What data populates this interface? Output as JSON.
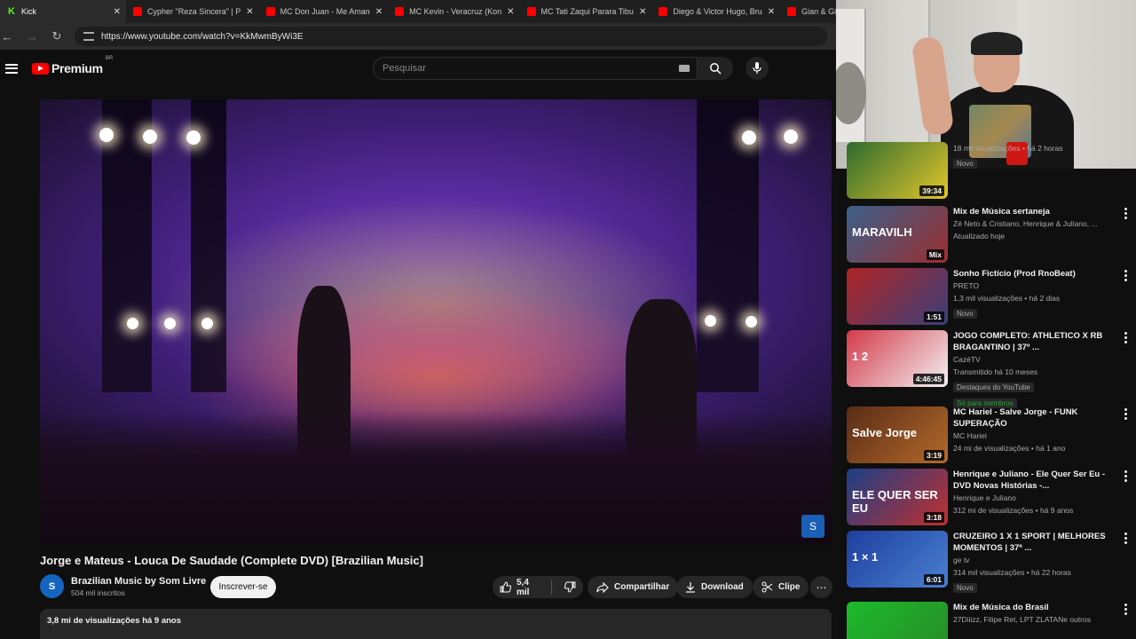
{
  "browser": {
    "tabs": [
      {
        "label": "Kick",
        "fav": "kick",
        "active": true
      },
      {
        "label": "Cypher \"Reza Sincera\" | P",
        "fav": "yt"
      },
      {
        "label": "MC Don Juan - Me Aman",
        "fav": "yt"
      },
      {
        "label": "MC Kevin - Veracruz (Kon",
        "fav": "yt"
      },
      {
        "label": "MC Tati Zaqui Parara Tibu",
        "fav": "yt"
      },
      {
        "label": "Diego & Victor Hugo, Bru",
        "fav": "yt"
      },
      {
        "label": "Gian & Giovani",
        "fav": "yt"
      }
    ],
    "close_glyph": "✕",
    "url": "https://www.youtube.com/watch?v=KkMwmByWi3E"
  },
  "youtube": {
    "logo_text": "Premium",
    "country_code": "BR",
    "search_placeholder": "Pesquisar"
  },
  "video": {
    "title": "Jorge e Mateus - Louca De Saudade (Complete DVD) [Brazilian Music]",
    "channel": "Brazilian Music by Som Livre",
    "subscribers": "504 mil inscritos",
    "subscribe_label": "Inscrever-se",
    "likes": "5,4 mil",
    "share_label": "Compartilhar",
    "download_label": "Download",
    "clip_label": "Clipe",
    "views_date": "3,8 mi de visualizações  há 9 anos"
  },
  "sidebar": {
    "items": [
      {
        "title": "",
        "lines": [
          "18 mil visualizações • há 2 horas"
        ],
        "badge": "Novo",
        "duration": "39:34",
        "colors": [
          "#2e6b2e",
          "#e2c62a"
        ]
      },
      {
        "title": "Mix de Música sertaneja",
        "lines": [
          "Zé Neto & Cristiano, Henrique & Juliano, ...",
          "Atualizado hoje"
        ],
        "mix": "Mix",
        "thumb_text": "MARAVILH",
        "colors": [
          "#3a5f8a",
          "#9b2f2f"
        ]
      },
      {
        "title": "Sonho Fictício (Prod RnoBeat)",
        "lines": [
          "PRETO",
          "1,3 mil visualizações • há 2 dias"
        ],
        "badge": "Novo",
        "duration": "1:51",
        "colors": [
          "#b02525",
          "#3a3f7a"
        ]
      },
      {
        "title": "JOGO COMPLETO: ATHLETICO X RB BRAGANTINO | 37º ...",
        "lines": [
          "CazéTV",
          "Transmitido há 10 meses"
        ],
        "badge": "Destaques do YouTube",
        "badge2": "Só para membros",
        "duration": "4:46:45",
        "thumb_text": "1 2",
        "colors": [
          "#d43a4a",
          "#f2f2f2"
        ]
      },
      {
        "title": "MC Hariel - Salve Jorge - FUNK SUPERAÇÃO",
        "lines": [
          "MC Hariel",
          "24 mi de visualizações • há 1 ano"
        ],
        "duration": "3:19",
        "thumb_text": "Salve Jorge",
        "colors": [
          "#5a2c16",
          "#b36a2a"
        ]
      },
      {
        "title": "Henrique e Juliano - Ele Quer Ser Eu - DVD Novas Histórias -...",
        "lines": [
          "Henrique e Juliano",
          "312 mi de visualizações • há 9 anos"
        ],
        "duration": "3:18",
        "thumb_text": "ELE QUER SER EU",
        "colors": [
          "#1b3f86",
          "#c13030"
        ]
      },
      {
        "title": "CRUZEIRO 1 X 1 SPORT | MELHORES MOMENTOS | 37ª ...",
        "lines": [
          "ge tv",
          "314 mil visualizações • há 22 horas"
        ],
        "badge": "Novo",
        "duration": "6:01",
        "thumb_text": "1 × 1",
        "colors": [
          "#1d3f9e",
          "#4a7fd0"
        ]
      },
      {
        "title": "Mix de Música do Brasil",
        "lines": [
          "27Diiizz, Filipe Ret, LPT ZLATANe outros"
        ],
        "colors": [
          "#1cba2a",
          "#2a8a2a"
        ]
      }
    ]
  },
  "colors": {
    "accent_red": "#ff0000",
    "kick_green": "#53fc18",
    "background": "#0f0f0f"
  }
}
